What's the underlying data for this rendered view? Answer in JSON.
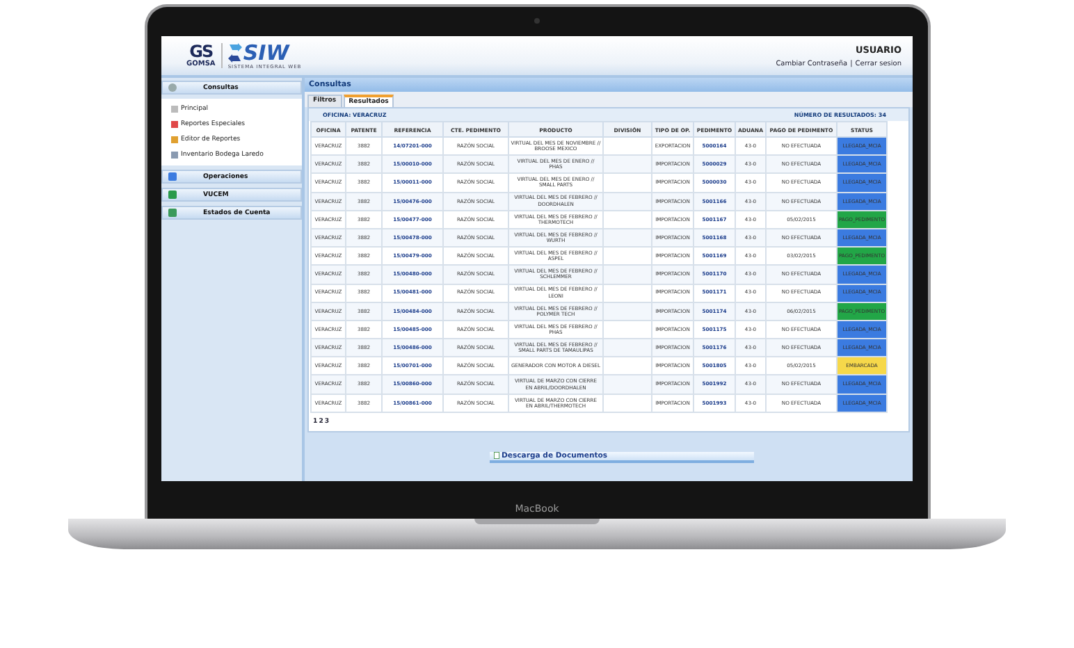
{
  "header": {
    "logo_mark": "GS",
    "logo_name": "GOMSA",
    "app_name": "SIW",
    "app_subtitle": "SISTEMA INTEGRAL WEB",
    "user": "USUARIO",
    "links": [
      "Cambiar Contraseña",
      "Cerrar sesion"
    ],
    "link_separator": "|"
  },
  "sidebar": {
    "sections": [
      {
        "label": "Consultas",
        "items": [
          "Principal",
          "Reportes Especiales",
          "Editor de Reportes",
          "Inventario Bodega Laredo"
        ]
      },
      {
        "label": "Operaciones"
      },
      {
        "label": "VUCEM"
      },
      {
        "label": "Estados de Cuenta"
      }
    ]
  },
  "main": {
    "title": "Consultas",
    "tabs": [
      {
        "label": "Filtros",
        "selected": false
      },
      {
        "label": "Resultados",
        "selected": true
      }
    ],
    "office": "OFICINA: VERACRUZ",
    "result_count": "NÚMERO DE RESULTADOS: 34",
    "table": {
      "columns": [
        "OFICINA",
        "PATENTE",
        "REFERENCIA",
        "CTE. PEDIMENTO",
        "PRODUCTO",
        "DIVISIÓN",
        "TIPO DE OP.",
        "PEDIMENTO",
        "ADUANA",
        "PAGO DE PEDIMENTO",
        "STATUS"
      ],
      "rows": [
        {
          "oficina": "VERACRUZ",
          "patente": "3882",
          "referencia": "14/07201-000",
          "cte_pedimento": "RAZÓN SOCIAL",
          "producto": "VIRTUAL DEL MES DE NOVIEMBRE // BROOSE MEXICO",
          "tipo": "EXPORTACION",
          "pedimento": "5000164",
          "aduana": "43-0",
          "pago": "NO EFECTUADA",
          "status": {
            "label": "LLEGADA_MCIA",
            "color": "#3b7be0"
          }
        },
        {
          "oficina": "VERACRUZ",
          "patente": "3882",
          "referencia": "15/00010-000",
          "cte_pedimento": "RAZÓN SOCIAL",
          "producto": "VIRTUAL DEL MES DE ENERO // PHAS",
          "tipo": "IMPORTACION",
          "pedimento": "5000029",
          "aduana": "43-0",
          "pago": "NO EFECTUADA",
          "status": {
            "label": "LLEGADA_MCIA",
            "color": "#3b7be0"
          }
        },
        {
          "oficina": "VERACRUZ",
          "patente": "3882",
          "referencia": "15/00011-000",
          "cte_pedimento": "RAZÓN SOCIAL",
          "producto": "VIRTUAL DEL MES DE ENERO // SMALL PARTS",
          "tipo": "IMPORTACION",
          "pedimento": "5000030",
          "aduana": "43-0",
          "pago": "NO EFECTUADA",
          "status": {
            "label": "LLEGADA_MCIA",
            "color": "#3b7be0"
          }
        },
        {
          "oficina": "VERACRUZ",
          "patente": "3882",
          "referencia": "15/00476-000",
          "cte_pedimento": "RAZÓN SOCIAL",
          "producto": "VIRTUAL DEL MES DE FEBRERO // DOORDHALEN",
          "tipo": "IMPORTACION",
          "pedimento": "5001166",
          "aduana": "43-0",
          "pago": "NO EFECTUADA",
          "status": {
            "label": "LLEGADA_MCIA",
            "color": "#3b7be0"
          }
        },
        {
          "oficina": "VERACRUZ",
          "patente": "3882",
          "referencia": "15/00477-000",
          "cte_pedimento": "RAZÓN SOCIAL",
          "producto": "VIRTUAL DEL MES DE FEBRERO // THERMOTECH",
          "tipo": "IMPORTACION",
          "pedimento": "5001167",
          "aduana": "43-0",
          "pago": "05/02/2015",
          "status": {
            "label": "PAGO_PEDIMENTO",
            "color": "#22a647"
          }
        },
        {
          "oficina": "VERACRUZ",
          "patente": "3882",
          "referencia": "15/00478-000",
          "cte_pedimento": "RAZÓN SOCIAL",
          "producto": "VIRTUAL DEL MES DE FEBRERO // WURTH",
          "tipo": "IMPORTACION",
          "pedimento": "5001168",
          "aduana": "43-0",
          "pago": "NO EFECTUADA",
          "status": {
            "label": "LLEGADA_MCIA",
            "color": "#3b7be0"
          }
        },
        {
          "oficina": "VERACRUZ",
          "patente": "3882",
          "referencia": "15/00479-000",
          "cte_pedimento": "RAZÓN SOCIAL",
          "producto": "VIRTUAL DEL MES DE FEBRERO // ASPEL",
          "tipo": "IMPORTACION",
          "pedimento": "5001169",
          "aduana": "43-0",
          "pago": "03/02/2015",
          "status": {
            "label": "PAGO_PEDIMENTO",
            "color": "#22a647"
          }
        },
        {
          "oficina": "VERACRUZ",
          "patente": "3882",
          "referencia": "15/00480-000",
          "cte_pedimento": "RAZÓN SOCIAL",
          "producto": "VIRTUAL DEL MES DE FEBRERO // SCHLEMMER",
          "tipo": "IMPORTACION",
          "pedimento": "5001170",
          "aduana": "43-0",
          "pago": "NO EFECTUADA",
          "status": {
            "label": "LLEGADA_MCIA",
            "color": "#3b7be0"
          }
        },
        {
          "oficina": "VERACRUZ",
          "patente": "3882",
          "referencia": "15/00481-000",
          "cte_pedimento": "RAZÓN SOCIAL",
          "producto": "VIRTUAL DEL MES DE FEBRERO // LEONI",
          "tipo": "IMPORTACION",
          "pedimento": "5001171",
          "aduana": "43-0",
          "pago": "NO EFECTUADA",
          "status": {
            "label": "LLEGADA_MCIA",
            "color": "#3b7be0"
          }
        },
        {
          "oficina": "VERACRUZ",
          "patente": "3882",
          "referencia": "15/00484-000",
          "cte_pedimento": "RAZÓN SOCIAL",
          "producto": "VIRTUAL DEL MES DE FEBRERO // POLYMER TECH",
          "tipo": "IMPORTACION",
          "pedimento": "5001174",
          "aduana": "43-0",
          "pago": "06/02/2015",
          "status": {
            "label": "PAGO_PEDIMENTO",
            "color": "#22a647"
          }
        },
        {
          "oficina": "VERACRUZ",
          "patente": "3882",
          "referencia": "15/00485-000",
          "cte_pedimento": "RAZÓN SOCIAL",
          "producto": "VIRTUAL DEL MES DE FEBRERO // PHAS",
          "tipo": "IMPORTACION",
          "pedimento": "5001175",
          "aduana": "43-0",
          "pago": "NO EFECTUADA",
          "status": {
            "label": "LLEGADA_MCIA",
            "color": "#3b7be0"
          }
        },
        {
          "oficina": "VERACRUZ",
          "patente": "3882",
          "referencia": "15/00486-000",
          "cte_pedimento": "RAZÓN SOCIAL",
          "producto": "VIRTUAL DEL MES DE FEBRERO // SMALL PARTS DE TAMAULIPAS",
          "tipo": "IMPORTACION",
          "pedimento": "5001176",
          "aduana": "43-0",
          "pago": "NO EFECTUADA",
          "status": {
            "label": "LLEGADA_MCIA",
            "color": "#3b7be0"
          }
        },
        {
          "oficina": "VERACRUZ",
          "patente": "3882",
          "referencia": "15/00701-000",
          "cte_pedimento": "RAZÓN SOCIAL",
          "producto": "GENERADOR CON MOTOR A DIESEL",
          "tipo": "IMPORTACION",
          "pedimento": "5001805",
          "aduana": "43-0",
          "pago": "05/02/2015",
          "status": {
            "label": "EMBARCADA",
            "color": "#f6d84a"
          }
        },
        {
          "oficina": "VERACRUZ",
          "patente": "3882",
          "referencia": "15/00860-000",
          "cte_pedimento": "RAZÓN SOCIAL",
          "producto": "VIRTUAL DE MARZO CON CIERRE EN ABRIL/DOORDHALEN",
          "tipo": "IMPORTACION",
          "pedimento": "5001992",
          "aduana": "43-0",
          "pago": "NO EFECTUADA",
          "status": {
            "label": "LLEGADA_MCIA",
            "color": "#3b7be0"
          }
        },
        {
          "oficina": "VERACRUZ",
          "patente": "3882",
          "referencia": "15/00861-000",
          "cte_pedimento": "RAZÓN SOCIAL",
          "producto": "VIRTUAL DE MARZO CON CIERRE EN ABRIL/THERMOTECH",
          "tipo": "IMPORTACION",
          "pedimento": "5001993",
          "aduana": "43-0",
          "pago": "NO EFECTUADA",
          "status": {
            "label": "LLEGADA_MCIA",
            "color": "#3b7be0"
          }
        }
      ]
    },
    "pages": [
      "1",
      "2",
      "3"
    ],
    "download_button": "Descarga de Documentos"
  },
  "device": {
    "label": "MacBook"
  }
}
